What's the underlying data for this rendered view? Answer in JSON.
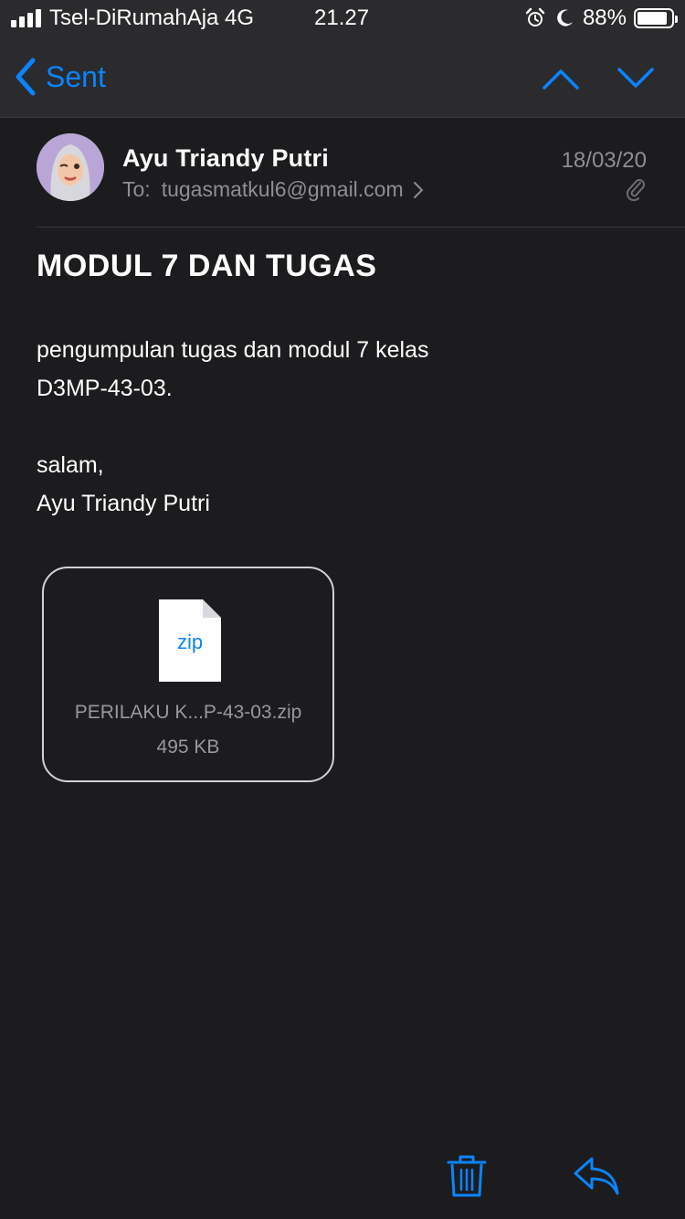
{
  "status_bar": {
    "carrier": "Tsel-DiRumahAja 4G",
    "time": "21.27",
    "battery_percent": "88%",
    "battery_level": 0.88,
    "icons": [
      "signal-icon",
      "alarm-icon",
      "moon-icon",
      "battery-icon"
    ]
  },
  "nav": {
    "back_label": "Sent",
    "up_icon": "chevron-up-icon",
    "down_icon": "chevron-down-icon"
  },
  "message": {
    "sender": "Ayu Triandy Putri",
    "to_label": "To:",
    "to_address": "tugasmatkul6@gmail.com",
    "date": "18/03/20",
    "subject": "MODUL 7 DAN TUGAS",
    "body": {
      "line1": "pengumpulan tugas dan modul 7 kelas",
      "line2": "D3MP-43-03.",
      "line3": "salam,",
      "line4": "Ayu Triandy Putri"
    },
    "attachment": {
      "type_label": "zip",
      "file_name": "PERILAKU K...P-43-03.zip",
      "file_size": "495 KB"
    }
  },
  "toolbar": {
    "trash_icon": "trash-icon",
    "reply_icon": "reply-icon"
  },
  "colors": {
    "accent": "#0a84ff",
    "background": "#1c1c1e",
    "bar": "#2b2b2d",
    "secondary_text": "#8e8e93"
  }
}
